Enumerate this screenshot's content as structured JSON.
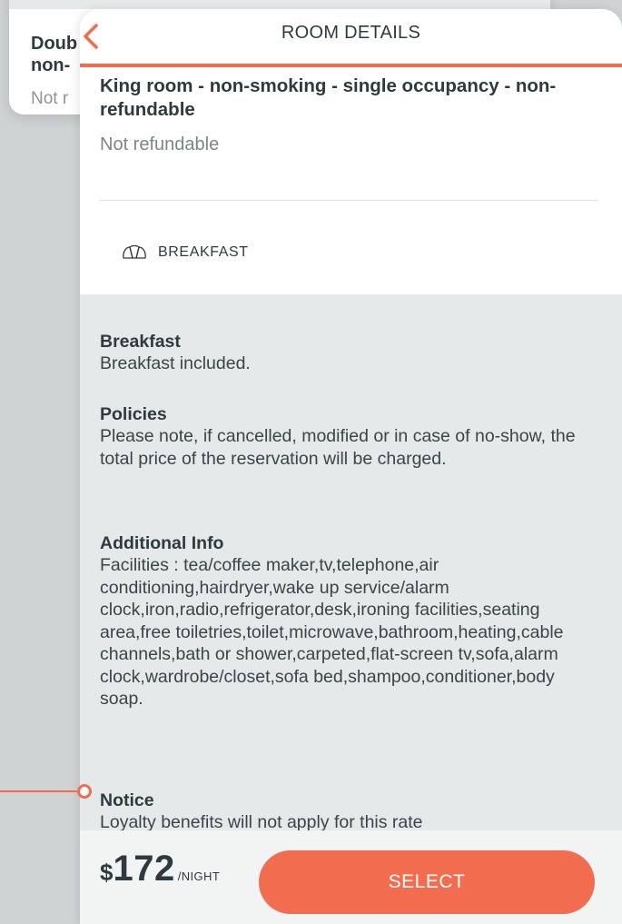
{
  "background_card": {
    "title": "Doub\nnon-",
    "subtitle": "Not r"
  },
  "modal": {
    "title": "ROOM DETAILS",
    "back_icon": "chevron-left-icon",
    "accent_color": "#f26c4f"
  },
  "room": {
    "name": "King room - non-smoking - single occupancy - non-refundable",
    "refund_status": "Not refundable",
    "amenity": {
      "icon": "croissant-icon",
      "label": "BREAKFAST"
    }
  },
  "sections": {
    "breakfast": {
      "heading": "Breakfast",
      "text": "Breakfast included."
    },
    "policies": {
      "heading": "Policies",
      "text": "Please note, if cancelled, modified or in case of no-show, the total price of the reservation will be charged."
    },
    "additional_info": {
      "heading": "Additional Info",
      "text": "Facilities : tea/coffee maker,tv,telephone,air conditioning,hairdryer,wake up service/alarm clock,iron,radio,refrigerator,desk,ironing facilities,seating area,free toiletries,toilet,microwave,bathroom,heating,cable channels,bath or shower,carpeted,flat-screen tv,sofa,alarm clock,wardrobe/closet,sofa bed,shampoo,conditioner,body soap."
    },
    "notice": {
      "heading": "Notice",
      "text": "Loyalty benefits will not apply for this rate"
    }
  },
  "footer": {
    "currency": "$",
    "price": "172",
    "unit": "/NIGHT",
    "select_label": "SELECT"
  }
}
